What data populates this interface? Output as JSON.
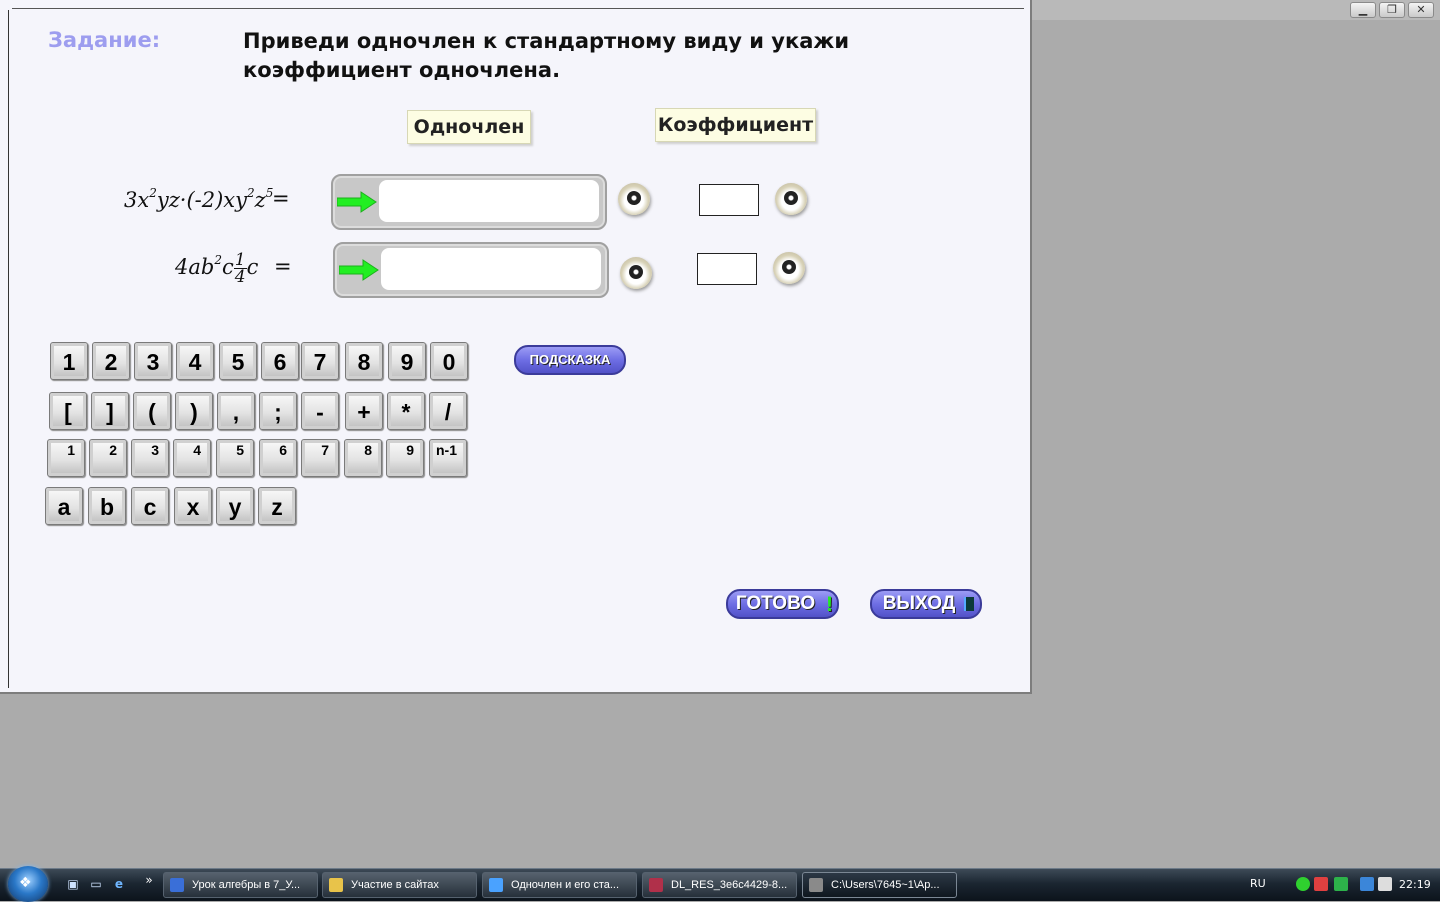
{
  "task": {
    "label": "Задание:",
    "text": "Приведи одночлен к стандартному виду и укажи коэффициент одночлена."
  },
  "headers": {
    "monomial": "Одночлен",
    "coefficient": "Коэффициент"
  },
  "rows": [
    {
      "expression": "3x²yz·(-2)xy²z⁵",
      "equals": "=",
      "answer": "",
      "coefficient": ""
    },
    {
      "expression": "4ab²c¼c",
      "equals": "=",
      "answer": "",
      "coefficient": ""
    }
  ],
  "keypad": {
    "digits": [
      "1",
      "2",
      "3",
      "4",
      "5",
      "6",
      "7",
      "8",
      "9",
      "0"
    ],
    "symbols": [
      "[",
      "]",
      "(",
      ")",
      ",",
      ";",
      "-",
      "+",
      "*",
      "/"
    ],
    "powers": [
      "1",
      "2",
      "3",
      "4",
      "5",
      "6",
      "7",
      "8",
      "9",
      "n-1"
    ],
    "letters": [
      "a",
      "b",
      "c",
      "x",
      "y",
      "z"
    ]
  },
  "buttons": {
    "hint": "ПОДСКАЗКА",
    "done": "ГОТОВО",
    "exit": "ВЫХОД"
  },
  "taskbar": {
    "items": [
      {
        "label": "Урок алгебры в 7_У...",
        "icon": "word-icon",
        "active": false
      },
      {
        "label": "Участие в сайтах",
        "icon": "folder-icon",
        "active": false
      },
      {
        "label": "Одночлен и его ста...",
        "icon": "ie-icon",
        "active": false
      },
      {
        "label": "DL_RES_3e6c4429-8...",
        "icon": "archive-icon",
        "active": false
      },
      {
        "label": "C:\\Users\\7645~1\\Ap...",
        "icon": "app-icon",
        "active": true
      }
    ],
    "language": "RU",
    "time": "22:19"
  },
  "colors": {
    "task_label": "#9d9def",
    "arrow": "#22ee22",
    "button": "#6e6ee4"
  }
}
